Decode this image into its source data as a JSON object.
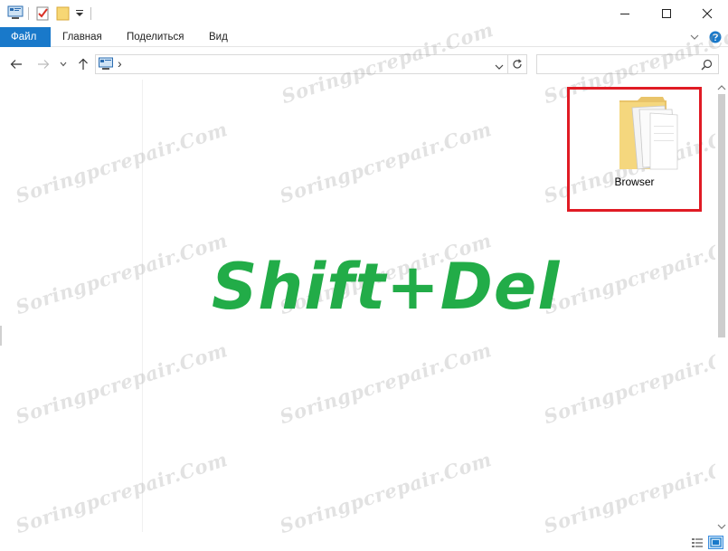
{
  "ribbon": {
    "tabs": [
      {
        "label": "Файл",
        "active": true
      },
      {
        "label": "Главная",
        "active": false
      },
      {
        "label": "Поделиться",
        "active": false
      },
      {
        "label": "Вид",
        "active": false
      }
    ]
  },
  "address": {
    "path_separator": "›"
  },
  "search": {
    "placeholder": ""
  },
  "content": {
    "overlay_text": "Shift+Del",
    "folder_name": "Browser",
    "watermark": "Soringpcrepair.Com"
  },
  "colors": {
    "accent": "#1979ca",
    "overlay_text": "#22ac48",
    "highlight_box": "#e01b24"
  },
  "icons": {
    "qa": [
      "computer-icon",
      "properties-check-icon",
      "new-folder-icon",
      "customize-dropdown-icon"
    ],
    "window": [
      "minimize-icon",
      "maximize-icon",
      "close-icon"
    ],
    "nav": [
      "back-arrow-icon",
      "forward-arrow-icon",
      "recent-dropdown-icon",
      "up-arrow-icon"
    ]
  }
}
